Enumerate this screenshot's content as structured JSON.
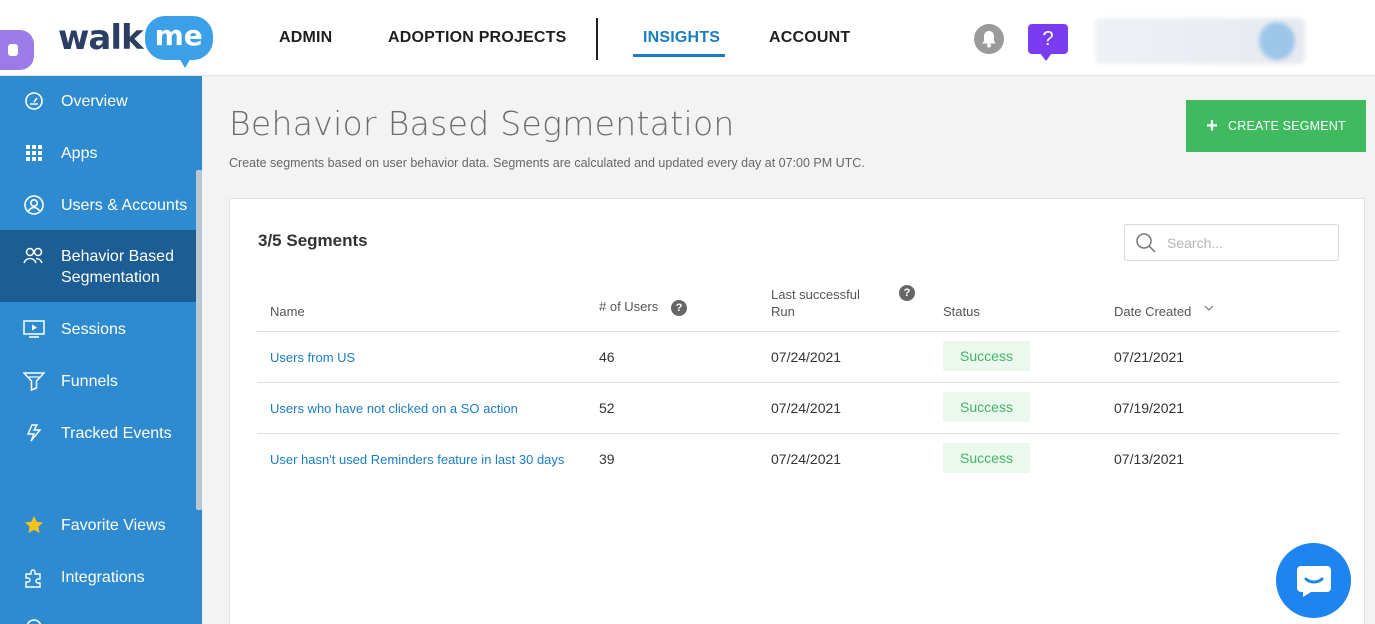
{
  "header": {
    "logo_walk": "walk",
    "logo_me": "me",
    "nav": {
      "admin": "ADMIN",
      "adoption_projects": "ADOPTION PROJECTS",
      "insights": "INSIGHTS",
      "account": "ACCOUNT"
    },
    "help_label": "?"
  },
  "sidebar": {
    "items": [
      {
        "label": "Overview",
        "icon": "gauge-icon"
      },
      {
        "label": "Apps",
        "icon": "grid-icon"
      },
      {
        "label": "Users & Accounts",
        "icon": "user-circle-icon"
      },
      {
        "label": "Behavior Based Segmentation",
        "label_line1": "Behavior Based",
        "label_line2": "Segmentation",
        "icon": "users-icon",
        "active": true
      },
      {
        "label": "Sessions",
        "icon": "play-screen-icon"
      },
      {
        "label": "Funnels",
        "icon": "funnel-icon"
      },
      {
        "label": "Tracked Events",
        "icon": "bolt-icon"
      },
      {
        "label": "Favorite Views",
        "icon": "star-icon"
      },
      {
        "label": "Integrations",
        "icon": "puzzle-icon"
      }
    ]
  },
  "main": {
    "title": "Behavior Based Segmentation",
    "subtitle": "Create segments based on user behavior data. Segments are calculated and updated every day at 07:00 PM UTC.",
    "create_button": "CREATE SEGMENT",
    "create_plus": "+",
    "card": {
      "title": "3/5 Segments",
      "search_placeholder": "Search...",
      "columns": {
        "name": "Name",
        "users": "# of Users",
        "last_run_line1": "Last successful",
        "last_run_line2": "Run",
        "status": "Status",
        "date_created": "Date Created"
      },
      "rows": [
        {
          "name": "Users from US",
          "users": "46",
          "last_run": "07/24/2021",
          "status": "Success",
          "date_created": "07/21/2021"
        },
        {
          "name": "Users who have not clicked on a SO action",
          "users": "52",
          "last_run": "07/24/2021",
          "status": "Success",
          "date_created": "07/19/2021"
        },
        {
          "name": "User hasn't used Reminders feature in last 30 days",
          "users": "39",
          "last_run": "07/24/2021",
          "status": "Success",
          "date_created": "07/13/2021"
        }
      ]
    }
  },
  "colors": {
    "sidebar": "#2f8bd0",
    "sidebar_active": "#1c5d93",
    "accent": "#1a7dc4",
    "create_button": "#3fba5f",
    "success_text": "#44b565",
    "success_bg": "#eaf8ee",
    "help": "#7a3cf0",
    "chat": "#1e84f0"
  }
}
